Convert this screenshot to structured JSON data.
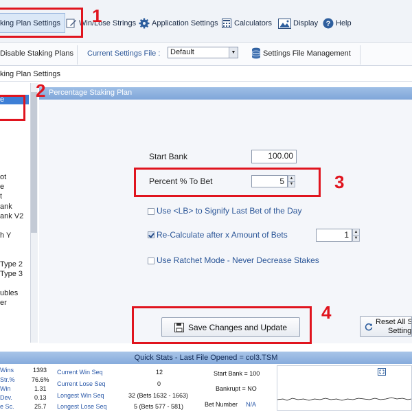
{
  "menubar": {
    "staking_plan_settings": "king Plan Settings",
    "win_lose_strings": "Win/Lose Strings",
    "application_settings": "Application Settings",
    "calculators": "Calculators",
    "display": "Display",
    "help": "Help"
  },
  "toolbar": {
    "disable_staking_plans": "Disable Staking Plans",
    "current_settings_file_label": "Current Settings File :",
    "current_settings_file_value": "Default",
    "settings_file_management": "Settings File Management"
  },
  "section_header": "king Plan Settings",
  "plan_list": {
    "selected": "e",
    "items": [
      "ot",
      "e",
      "t",
      "ank",
      "ank V2",
      "h Y",
      "Type 2",
      "Type 3",
      "ubles",
      "er"
    ]
  },
  "panel": {
    "title": "Percentage Staking Plan",
    "start_bank_label": "Start Bank",
    "start_bank_value": "100.00",
    "percent_label": "Percent % To Bet",
    "percent_value": "5",
    "use_lb_label": "Use <LB> to Signify Last Bet of the Day",
    "use_lb_checked": false,
    "recalc_label": "Re-Calculate after x Amount of Bets",
    "recalc_checked": true,
    "recalc_value": "1",
    "ratchet_label": "Use Ratchet Mode - Never Decrease Stakes",
    "ratchet_checked": false,
    "save_button": "Save Changes and Update",
    "reset_button_line1": "Reset All S",
    "reset_button_line2": "Settings t"
  },
  "annotations": {
    "n1": "1",
    "n2": "2",
    "n3": "3",
    "n4": "4"
  },
  "quick_stats": {
    "title": "Quick Stats - Last File Opened = col3.TSM",
    "left": [
      {
        "label": "Wins",
        "value": "1393"
      },
      {
        "label": "Str.%",
        "value": "76.6%"
      },
      {
        "label": "Win",
        "value": "1.31"
      },
      {
        "label": "Dev.",
        "value": "0.13"
      },
      {
        "label": "e Sc.",
        "value": "25.7"
      }
    ],
    "current_win_seq_label": "Current Win Seq",
    "current_win_seq_value": "12",
    "current_lose_seq_label": "Current Lose Seq",
    "current_lose_seq_value": "0",
    "longest_win_seq_label": "Longest Win Seq",
    "longest_win_seq_value": "32  (Bets 1632 - 1663)",
    "longest_lose_seq_label": "Longest Lose Seq",
    "longest_lose_seq_value": "5  (Bets 577 - 581)",
    "start_bank": "Start Bank = 100",
    "bankrupt": "Bankrupt = NO",
    "bet_number_label": "Bet Number",
    "bet_number_value": "N/A"
  },
  "colors": {
    "accent": "#3d7fd6",
    "annotation_red": "#e0141e",
    "link_blue": "#2a5597"
  }
}
